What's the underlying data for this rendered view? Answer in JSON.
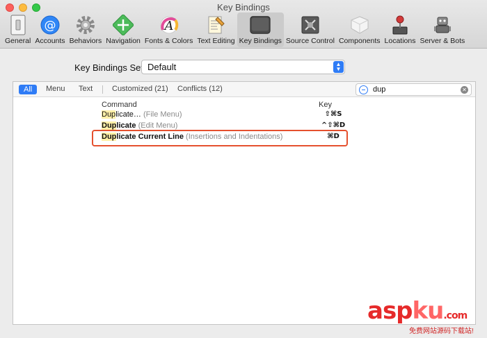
{
  "window": {
    "title": "Key Bindings"
  },
  "toolbar": {
    "items": [
      {
        "label": "General",
        "icon": "general-icon"
      },
      {
        "label": "Accounts",
        "icon": "accounts-icon"
      },
      {
        "label": "Behaviors",
        "icon": "behaviors-icon"
      },
      {
        "label": "Navigation",
        "icon": "navigation-icon"
      },
      {
        "label": "Fonts & Colors",
        "icon": "fonts-colors-icon"
      },
      {
        "label": "Text Editing",
        "icon": "text-editing-icon"
      },
      {
        "label": "Key Bindings",
        "icon": "key-bindings-icon",
        "selected": true
      },
      {
        "label": "Source Control",
        "icon": "source-control-icon"
      },
      {
        "label": "Components",
        "icon": "components-icon"
      },
      {
        "label": "Locations",
        "icon": "locations-icon"
      },
      {
        "label": "Server & Bots",
        "icon": "server-bots-icon"
      }
    ]
  },
  "key_bindings_set": {
    "label": "Key Bindings Set",
    "value": "Default"
  },
  "filters": {
    "all": "All",
    "menu": "Menu",
    "text": "Text",
    "customized": "Customized (21)",
    "conflicts": "Conflicts (12)"
  },
  "search": {
    "value": "dup"
  },
  "table": {
    "headers": {
      "command": "Command",
      "key": "Key"
    },
    "rows": [
      {
        "match": "Dup",
        "rest": "licate…",
        "bold": false,
        "context": "(File Menu)",
        "key": "⇧⌘S"
      },
      {
        "match": "Dup",
        "rest": "licate",
        "bold": true,
        "context": "(Edit Menu)",
        "key": "^⇧⌘D"
      },
      {
        "match": "Dup",
        "rest": "licate Current Line",
        "bold": true,
        "context": "(Insertions and Indentations)",
        "key": "⌘D"
      }
    ]
  },
  "watermark": {
    "main": "asp",
    "accent": "ku",
    "tld": ".com",
    "sub": "免费网站源码下载站!"
  },
  "colors": {
    "accent": "#2f7cf6",
    "highlight_box": "#e5502e",
    "match_highlight": "#fff0a8"
  }
}
